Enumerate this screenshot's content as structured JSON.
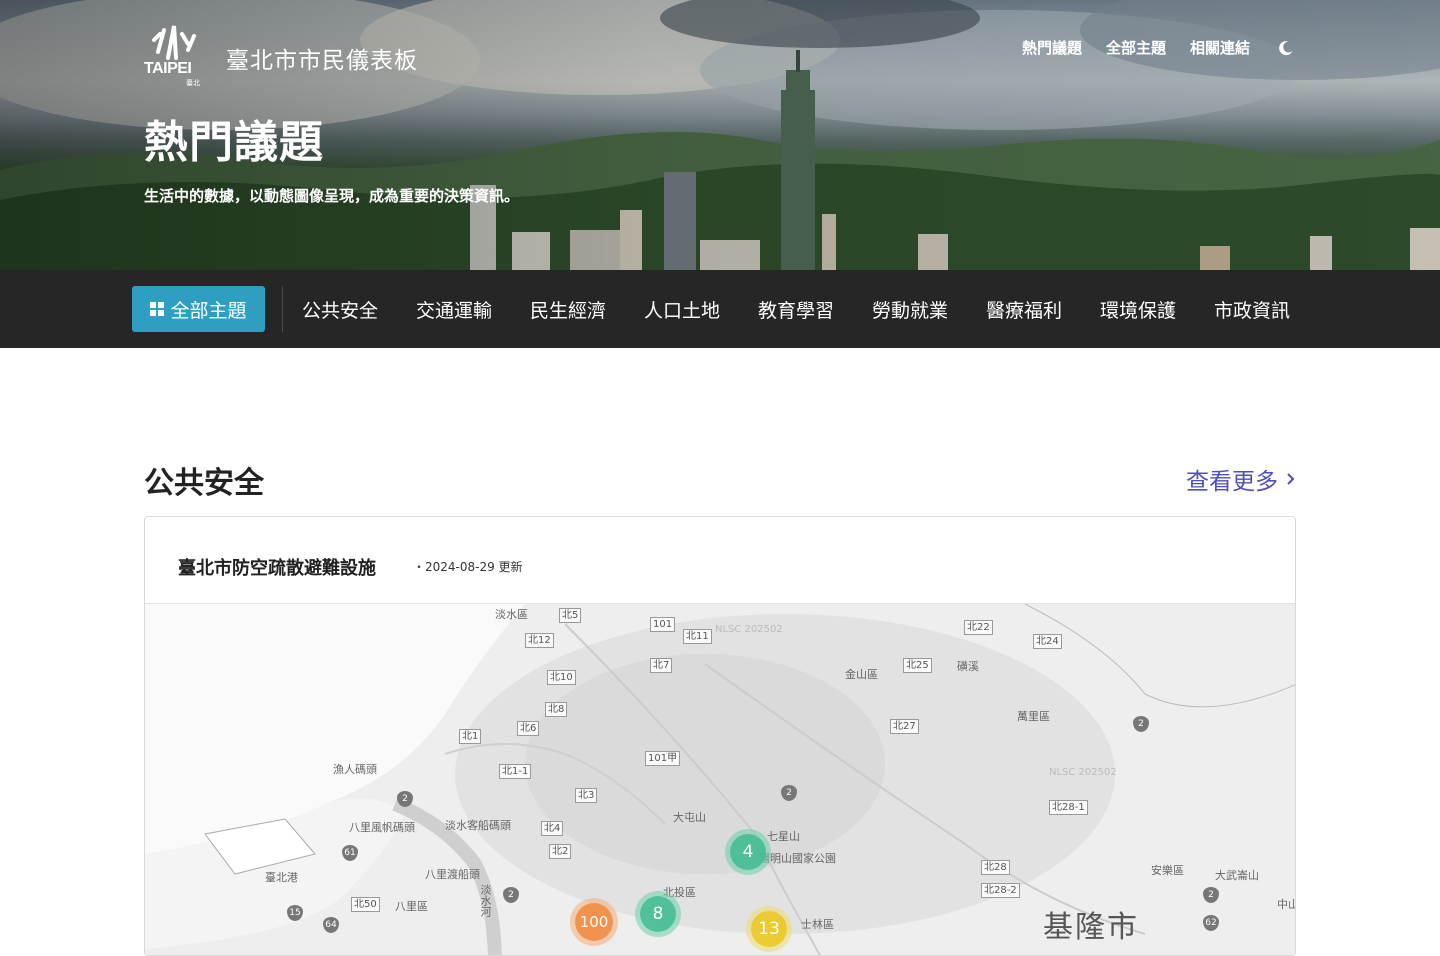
{
  "header": {
    "logo_word": "TAIPEI",
    "logo_sub": "臺北",
    "site_title": "臺北市市民儀表板",
    "nav": [
      "熱門議題",
      "全部主題",
      "相關連結"
    ],
    "theme_toggle_icon": "moon-icon"
  },
  "hero": {
    "title": "熱門議題",
    "subtitle": "生活中的數據，以動態圖像呈現，成為重要的決策資訊。"
  },
  "categories": {
    "all_label": "全部主題",
    "items": [
      "公共安全",
      "交通運輸",
      "民生經濟",
      "人口土地",
      "教育學習",
      "勞動就業",
      "醫療福利",
      "環境保護",
      "市政資訊"
    ]
  },
  "section": {
    "title": "公共安全",
    "more_label": "查看更多"
  },
  "card": {
    "title": "臺北市防空疏散避難設施",
    "updated": "・2024-08-29 更新"
  },
  "map": {
    "labels": {
      "danshui": "淡水區",
      "jinshan": "金山區",
      "wanli": "萬里區",
      "fishport": "漁人碼頭",
      "bali_sail": "八里風帆碼頭",
      "danshui_pier": "淡水客船碼頭",
      "bali_ferry": "八里渡船頭",
      "taipei_port": "臺北港",
      "bali": "八里區",
      "datun": "大屯山",
      "qixing": "七星山",
      "yangming": "陽明山國家公園",
      "beitou": "北投區",
      "shilin": "士林區",
      "anle": "安樂區",
      "dawu": "大武崙山",
      "river": "淡水河",
      "keelung": "基隆市",
      "zhong": "中山",
      "jixi": "磺溪",
      "nlsc1": "NLSC 202502",
      "nlsc2": "NLSC 202502"
    },
    "roads": [
      "北5",
      "北12",
      "北10",
      "北8",
      "北6",
      "北1",
      "北1-1",
      "北3",
      "北4",
      "北2",
      "北50",
      "101",
      "北11",
      "北7",
      "101甲",
      "北22",
      "北24",
      "北25",
      "北27",
      "北28-1",
      "北28",
      "北28-2"
    ],
    "shields": [
      "2",
      "2",
      "61",
      "15",
      "64",
      "2",
      "2",
      "2",
      "62"
    ],
    "clusters": [
      {
        "count": "4",
        "color": "green"
      },
      {
        "count": "8",
        "color": "green"
      },
      {
        "count": "100",
        "color": "orange"
      },
      {
        "count": "13",
        "color": "yellow"
      }
    ]
  }
}
